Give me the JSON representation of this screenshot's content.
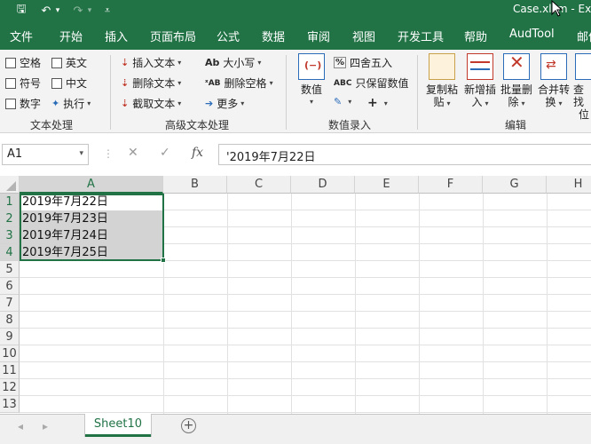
{
  "window": {
    "title": "Case.xlsm - Ex"
  },
  "qat": {
    "save": "🖫",
    "undo": "↶",
    "undo_dd": "▾",
    "redo": "↷",
    "redo_dd": "▾",
    "customize": "⩡"
  },
  "tabs": [
    "文件",
    "开始",
    "插入",
    "页面布局",
    "公式",
    "数据",
    "审阅",
    "视图",
    "开发工具",
    "帮助",
    "AudTool",
    "邮件"
  ],
  "ribbon": {
    "text_proc": {
      "checkboxes": [
        "空格",
        "英文",
        "符号",
        "中文",
        "数字"
      ],
      "exec": "执行",
      "group_label": "文本处理"
    },
    "adv_text": {
      "insert": "插入文本",
      "delete": "删除文本",
      "extract": "截取文本",
      "case": "大小写",
      "delete_space": "删除空格",
      "more": "更多",
      "group_label": "高级文本处理"
    },
    "num_input": {
      "value_btn": "数值",
      "round": "四舍五入",
      "keep_value": "只保留数值",
      "group_label": "数值录入"
    },
    "edit": {
      "copy_paste": [
        "复制粘",
        "贴"
      ],
      "new_insert": [
        "新增插",
        "入"
      ],
      "batch_delete": [
        "批量删",
        "除"
      ],
      "merge_convert": [
        "合并转",
        "换"
      ],
      "lookup": [
        "查找",
        "位"
      ],
      "group_label": "编辑"
    }
  },
  "formula_bar": {
    "name_box": "A1",
    "cancel": "✕",
    "enter": "✓",
    "fx": "fx",
    "formula": "'2019年7月22日"
  },
  "columns": [
    "A",
    "B",
    "C",
    "D",
    "E",
    "F",
    "G",
    "H"
  ],
  "rows": [
    "1",
    "2",
    "3",
    "4",
    "5",
    "6",
    "7",
    "8",
    "9",
    "10",
    "11",
    "12",
    "13"
  ],
  "cells_A": [
    "2019年7月22日",
    "2019年7月23日",
    "2019年7月24日",
    "2019年7月25日"
  ],
  "sheet_tab": "Sheet10",
  "add_sheet": "+",
  "nav": {
    "prev": "◂",
    "next": "▸"
  }
}
